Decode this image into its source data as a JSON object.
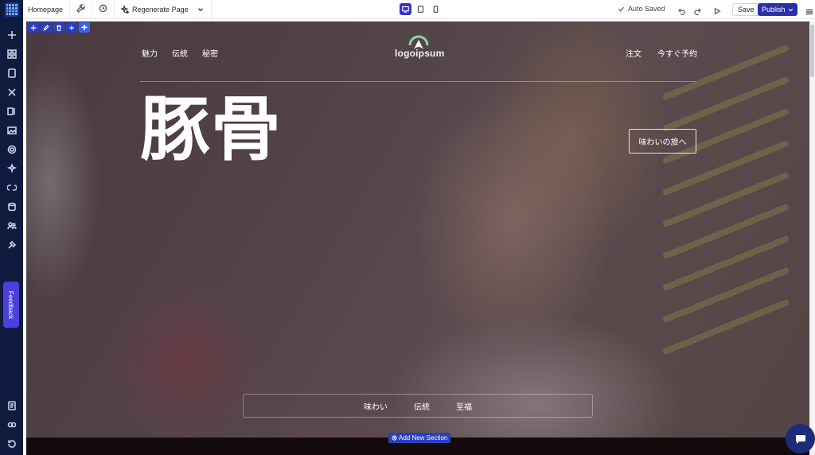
{
  "editor": {
    "page_name": "Homepage",
    "regenerate_label": "Regenerate Page",
    "autosave_label": "Auto Saved",
    "save_label": "Save",
    "publish_label": "Publish",
    "feedback_label": "Feedback",
    "add_section_label": "Add New Section",
    "active_device": "desktop"
  },
  "site": {
    "nav_left": [
      "魅力",
      "伝統",
      "秘密"
    ],
    "nav_right": [
      "注文",
      "今すぐ予約"
    ],
    "logo_text": "logoipsum",
    "hero_title": "豚骨",
    "cta_label": "味わいの旅へ",
    "bottom_nav": [
      "味わい",
      "伝統",
      "至福"
    ]
  },
  "colors": {
    "sidebar_bg": "#0f1c3f",
    "accent": "#3b2fd0",
    "publish_bg": "#2a2fa6",
    "feedback_bg": "#4b3fe0",
    "logo_arc": "#8fd4a8"
  }
}
